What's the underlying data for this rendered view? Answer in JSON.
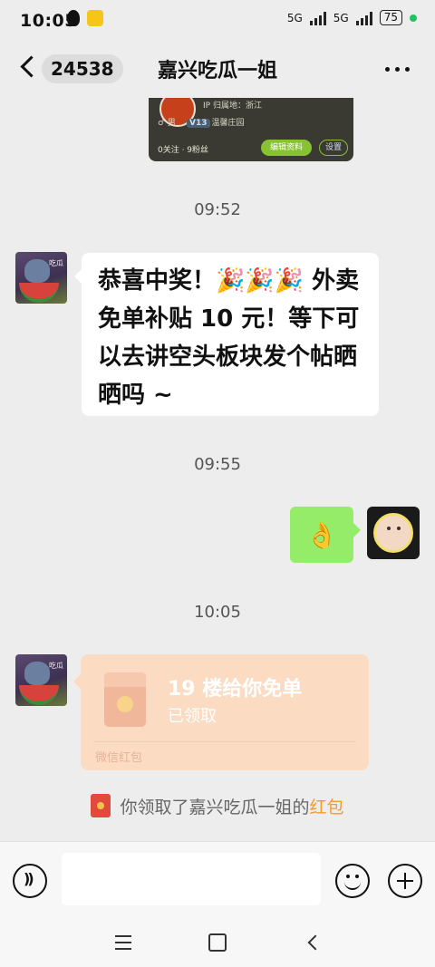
{
  "status_bar": {
    "time": "10:05",
    "network_1": "5G",
    "network_2": "5G",
    "battery": "75"
  },
  "nav": {
    "unread_count": "24538",
    "title": "嘉兴吃瓜一姐"
  },
  "profile_card": {
    "ip_location": "IP 归属地：浙江",
    "gender": "♂ 男",
    "level": "V13",
    "level_name": "温馨庄园",
    "follow_stats": "0关注 · 9粉丝",
    "edit_button": "编辑资料",
    "settings_button": "设置"
  },
  "avatar_tag": "吃瓜",
  "messages": {
    "time_1": "09:52",
    "msg_1": "恭喜中奖！🎉🎉🎉 外卖免单补贴 10 元！等下可以去讲空头板块发个帖晒晒吗 ~",
    "time_2": "09:55",
    "msg_2": "👌",
    "time_3": "10:05"
  },
  "red_packet": {
    "title": "19 楼给你免单",
    "status": "已领取",
    "footer": "微信红包"
  },
  "system_note": {
    "prefix": "你领取了嘉兴吃瓜一姐的",
    "highlight": "红包"
  },
  "input": {
    "placeholder": ""
  },
  "icons": [
    "back-chevron-icon",
    "more-icon",
    "voice-icon",
    "emoji-icon",
    "plus-icon",
    "red-packet-icon"
  ],
  "colors": {
    "background": "#ededed",
    "sent_bubble": "#95ec69",
    "red_packet": "#fbdcc3",
    "highlight": "#f39b2e"
  }
}
